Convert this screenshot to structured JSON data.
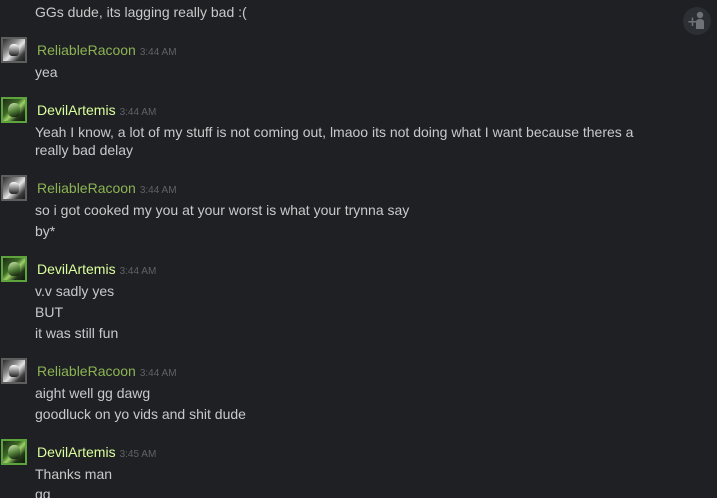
{
  "toolbar": {
    "add_friend_icon": "add-user-icon"
  },
  "messages": [
    {
      "user": null,
      "lines": [
        "GGs dude, its lagging really bad :("
      ]
    },
    {
      "user": "ReliableRacoon",
      "time": "3:44 AM",
      "color": "#8db454",
      "lines": [
        "yea"
      ]
    },
    {
      "user": "DevilArtemis",
      "time": "3:44 AM",
      "color": "#dbff9d",
      "lines": [
        "Yeah I know, a lot of my stuff is not coming out, lmaoo its not doing what I want because theres a",
        "really bad delay"
      ]
    },
    {
      "user": "ReliableRacoon",
      "time": "3:44 AM",
      "color": "#8db454",
      "lines": [
        "so i got cooked my you at your worst is what your trynna say",
        "by*"
      ]
    },
    {
      "user": "DevilArtemis",
      "time": "3:44 AM",
      "color": "#dbff9d",
      "lines": [
        "v.v sadly yes",
        "BUT",
        "it was still fun"
      ]
    },
    {
      "user": "ReliableRacoon",
      "time": "3:44 AM",
      "color": "#8db454",
      "lines": [
        "aight well gg dawg",
        "goodluck on yo vids and shit dude"
      ]
    },
    {
      "user": "DevilArtemis",
      "time": "3:45 AM",
      "color": "#dbff9d",
      "lines": [
        "Thanks man",
        "gg"
      ]
    }
  ]
}
